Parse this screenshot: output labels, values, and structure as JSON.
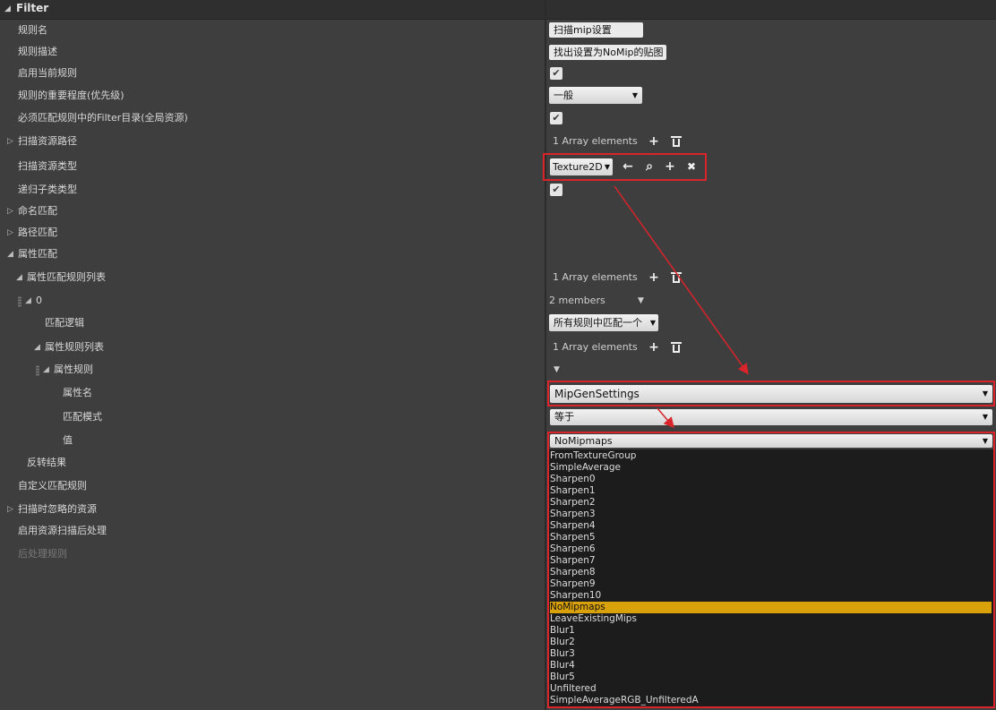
{
  "panel": {
    "title": "Filter"
  },
  "labels": {
    "rule_name": "规则名",
    "rule_desc": "规则描述",
    "enable_rule": "启用当前规则",
    "priority": "规则的重要程度(优先级)",
    "must_match_filter": "必须匹配规则中的Filter目录(全局资源)",
    "scan_paths": "扫描资源路径",
    "scan_types": "扫描资源类型",
    "recursive_subclass": "递归子类类型",
    "name_match": "命名匹配",
    "path_match": "路径匹配",
    "property_match": "属性匹配",
    "property_rule_list": "属性匹配规则列表",
    "index0": "0",
    "match_logic": "匹配逻辑",
    "property_rules": "属性规则列表",
    "property_rule": "属性规则",
    "property_name": "属性名",
    "match_mode": "匹配模式",
    "value": "值",
    "invert": "反转结果",
    "custom_rule": "自定义匹配规则",
    "ignore_assets": "扫描时忽略的资源",
    "enable_post": "启用资源扫描后处理",
    "post_rules": "后处理规则"
  },
  "values": {
    "rule_name": "扫描mip设置",
    "rule_desc": "找出设置为NoMip的贴图",
    "priority": "一般",
    "scan_paths_count": "1 Array elements",
    "scan_type": "Texture2D",
    "rule_list_count": "1 Array elements",
    "members": "2 members",
    "match_logic": "所有规则中匹配一个",
    "property_rules_count": "1 Array elements",
    "property_name": "MipGenSettings",
    "match_mode": "等于",
    "value": "NoMipmaps"
  },
  "dropdown": {
    "selected": "NoMipmaps",
    "options": [
      "FromTextureGroup",
      "SimpleAverage",
      "Sharpen0",
      "Sharpen1",
      "Sharpen2",
      "Sharpen3",
      "Sharpen4",
      "Sharpen5",
      "Sharpen6",
      "Sharpen7",
      "Sharpen8",
      "Sharpen9",
      "Sharpen10",
      "NoMipmaps",
      "LeaveExistingMips",
      "Blur1",
      "Blur2",
      "Blur3",
      "Blur4",
      "Blur5",
      "Unfiltered",
      "SimpleAverageRGB_UnfilteredA"
    ]
  },
  "icons": {
    "check": "✔",
    "add": "+",
    "back": "←",
    "browse": "⌕",
    "clear": "✖",
    "expand": "▷",
    "collapse": "◢",
    "dropdown": "▼"
  },
  "colors": {
    "background": "#3e3e3e",
    "highlight": "#d9a10a",
    "annotation_red": "#d8242a"
  }
}
